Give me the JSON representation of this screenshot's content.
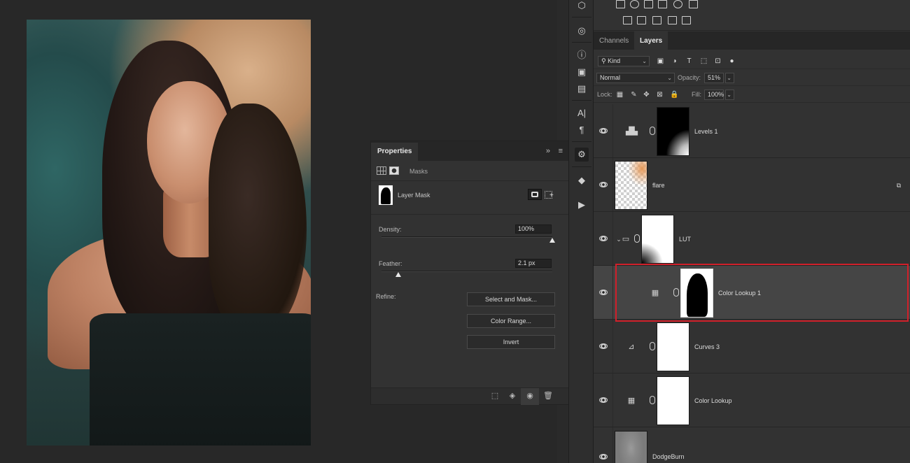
{
  "app": {
    "accent_color": "#d0202a",
    "background_color": "#282828",
    "panel_color": "#323232"
  },
  "properties_panel": {
    "tab_label": "Properties",
    "collapse_icon": "double-chevron-right-icon",
    "menu_icon": "panel-menu-icon",
    "mode_label": "Masks",
    "mask_title": "Layer Mask",
    "density": {
      "label": "Density:",
      "value": "100%",
      "fraction": 1.0
    },
    "feather": {
      "label": "Feather:",
      "value": "2.1 px",
      "fraction": 0.1
    },
    "refine_label": "Refine:",
    "buttons": {
      "select_and_mask": "Select and Mask...",
      "color_range": "Color Range...",
      "invert": "Invert"
    },
    "footer_icons": [
      "load-selection-icon",
      "apply-mask-icon",
      "visibility-eye-icon",
      "trash-icon"
    ]
  },
  "layers_panel": {
    "tabs": {
      "channels": "Channels",
      "layers": "Layers"
    },
    "filter_kind": "Kind",
    "blend_mode": "Normal",
    "opacity_label": "Opacity:",
    "opacity_value": "51%",
    "lock_label": "Lock:",
    "fill_label": "Fill:",
    "fill_value": "100%",
    "layers": [
      {
        "name": "Levels 1",
        "type": "levels-adjustment",
        "visible": true,
        "selected": false
      },
      {
        "name": "flare",
        "type": "smart-object",
        "visible": true,
        "selected": false
      },
      {
        "name": "LUT",
        "type": "group",
        "visible": true,
        "selected": false
      },
      {
        "name": "Color Lookup 1",
        "type": "color-lookup-adjustment",
        "visible": true,
        "selected": true
      },
      {
        "name": "Curves 3",
        "type": "curves-adjustment",
        "visible": true,
        "selected": false
      },
      {
        "name": "Color Lookup",
        "type": "color-lookup-adjustment",
        "visible": true,
        "selected": false
      },
      {
        "name": "DodgeBurn",
        "type": "pixel",
        "visible": true,
        "selected": false
      }
    ]
  }
}
